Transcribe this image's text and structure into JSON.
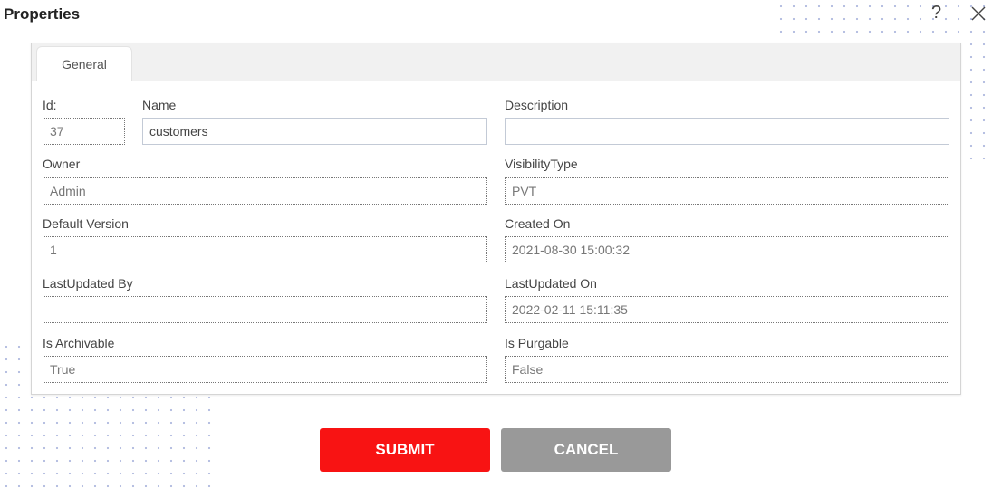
{
  "dialog": {
    "title": "Properties",
    "help_icon": "?",
    "close_icon": "close"
  },
  "tabs": [
    {
      "label": "General",
      "active": true
    }
  ],
  "fields": {
    "id": {
      "label": "Id:",
      "value": "37",
      "readonly": true
    },
    "name": {
      "label": "Name",
      "value": "customers",
      "readonly": false
    },
    "description": {
      "label": "Description",
      "value": "",
      "readonly": false
    },
    "owner": {
      "label": "Owner",
      "value": "Admin",
      "readonly": true
    },
    "visibility_type": {
      "label": "VisibilityType",
      "value": "PVT",
      "readonly": true
    },
    "default_version": {
      "label": "Default Version",
      "value": "1",
      "readonly": true
    },
    "created_on": {
      "label": "Created On",
      "value": "2021-08-30 15:00:32",
      "readonly": true
    },
    "last_updated_by": {
      "label": "LastUpdated By",
      "value": "",
      "readonly": true
    },
    "last_updated_on": {
      "label": "LastUpdated On",
      "value": "2022-02-11 15:11:35",
      "readonly": true
    },
    "is_archivable": {
      "label": "Is Archivable",
      "value": "True",
      "readonly": true
    },
    "is_purgable": {
      "label": "Is Purgable",
      "value": "False",
      "readonly": true
    }
  },
  "buttons": {
    "submit": "SUBMIT",
    "cancel": "CANCEL"
  },
  "colors": {
    "submit": "#f81313",
    "cancel": "#999999"
  }
}
